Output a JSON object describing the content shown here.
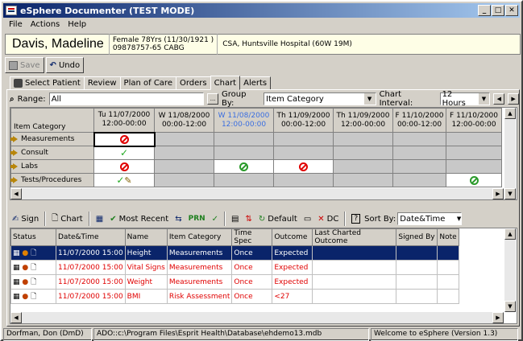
{
  "window": {
    "title": "eSphere Documenter (TEST MODE)"
  },
  "menu": [
    "File",
    "Actions",
    "Help"
  ],
  "patient": {
    "name": "Davis, Madeline",
    "info_line1": "Female 78Yrs (11/30/1921 )",
    "info_line2": "09878757-65 CABG",
    "location": "CSA, Huntsville Hospital (60W 19M)"
  },
  "toolbar": {
    "save_label": "Save",
    "undo_label": "Undo"
  },
  "tabs": [
    "Select Patient",
    "Review",
    "Plan of Care",
    "Orders",
    "Chart",
    "Alerts"
  ],
  "active_tab": "Chart",
  "range": {
    "label": "Range:",
    "value": "All",
    "browse": "..."
  },
  "groupby": {
    "label": "Group By:",
    "value": "Item Category"
  },
  "interval": {
    "label": "Chart Interval:",
    "value": "12 Hours"
  },
  "chart_grid": {
    "corner": "Item Category",
    "columns": [
      {
        "l1": "Tu 11/07/2000",
        "l2": "12:00-00:00",
        "accent": false
      },
      {
        "l1": "W 11/08/2000",
        "l2": "00:00-12:00",
        "accent": false
      },
      {
        "l1": "W 11/08/2000",
        "l2": "12:00-00:00",
        "accent": true
      },
      {
        "l1": "Th 11/09/2000",
        "l2": "00:00-12:00",
        "accent": false
      },
      {
        "l1": "Th 11/09/2000",
        "l2": "12:00-00:00",
        "accent": false
      },
      {
        "l1": "F 11/10/2000",
        "l2": "00:00-12:00",
        "accent": false
      },
      {
        "l1": "F 11/10/2000",
        "l2": "12:00-00:00",
        "accent": false
      }
    ],
    "rows": [
      "Measurements",
      "Consult",
      "Labs",
      "Tests/Procedures"
    ]
  },
  "toolbar2": {
    "sign": "Sign",
    "chart": "Chart",
    "most_recent": "Most Recent",
    "default": "Default",
    "dc": "DC",
    "sortby_label": "Sort By:",
    "sortby_value": "Date&Time"
  },
  "orders": {
    "headers": [
      "Status",
      "Date&Time",
      "Name",
      "Item Category",
      "Time Spec",
      "Outcome",
      "Last Charted Outcome",
      "Signed By",
      "Note"
    ],
    "rows": [
      {
        "datetime": "11/07/2000 15:00",
        "name": "Height",
        "category": "Measurements",
        "timespec": "Once",
        "outcome": "Expected"
      },
      {
        "datetime": "11/07/2000 15:00",
        "name": "Vital Signs",
        "category": "Measurements",
        "timespec": "Once",
        "outcome": "Expected"
      },
      {
        "datetime": "11/07/2000 15:00",
        "name": "Weight",
        "category": "Measurements",
        "timespec": "Once",
        "outcome": "Expected"
      },
      {
        "datetime": "11/07/2000 15:00",
        "name": "BMI",
        "category": "Risk Assessment",
        "timespec": "Once",
        "outcome": "<27"
      }
    ]
  },
  "status": {
    "user": "Dorfman, Don (DmD)",
    "db": "ADO::c:\\Program Files\\Esprit Health\\Database\\ehdemo13.mdb",
    "welcome": "Welcome to eSphere (Version 1.3)"
  },
  "colors": {
    "titlebar": "#0a246a",
    "selection": "#0a246a",
    "order_text": "#e00000",
    "panel": "#d4d0c8",
    "patient_bg": "#fefee6"
  }
}
